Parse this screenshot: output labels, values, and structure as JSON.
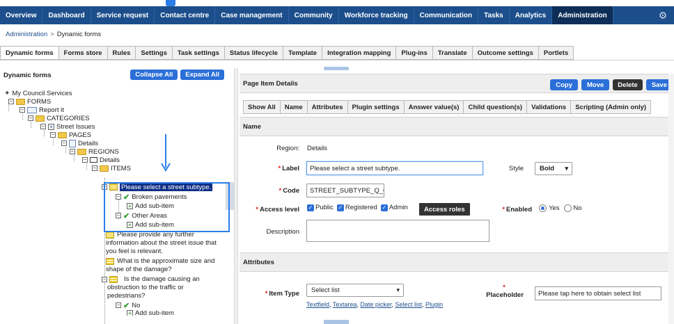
{
  "nav": {
    "items": [
      "Overview",
      "Dashboard",
      "Service request",
      "Contact centre",
      "Case management",
      "Community",
      "Workforce tracking",
      "Communication",
      "Tasks",
      "Analytics",
      "Administration"
    ],
    "active": "Administration"
  },
  "breadcrumb": {
    "root": "Administration",
    "sep": ">",
    "current": "Dynamic forms"
  },
  "subtabs": [
    "Dynamic forms",
    "Forms store",
    "Rules",
    "Settings",
    "Task settings",
    "Status lifecycle",
    "Template",
    "Integration mapping",
    "Plug-ins",
    "Translate",
    "Outcome settings",
    "Portlets"
  ],
  "left": {
    "title": "Dynamic forms",
    "collapse_label": "Collapse All",
    "expand_label": "Expand All",
    "tree": {
      "root": "My Council Services",
      "forms": "FORMS",
      "report": "Report it",
      "categories": "CATEGORIES",
      "street": "Street Issues",
      "pages": "PAGES",
      "details_page": "Details",
      "regions": "REGIONS",
      "details_region": "Details",
      "items": "ITEMS",
      "selected": "Please select a street subtype.",
      "broken": "Broken pavements",
      "add1": "Add sub-item",
      "other": "Other Areas",
      "add2": "Add sub-item",
      "q1": "Please provide any further information about the street issue that you feel is relevant.",
      "q2": "What is the approximate size and shape of the damage?",
      "q3": "Is the damage causing an obstruction to the traffic or pedestrians?",
      "no": "No",
      "add3": "Add sub-item"
    }
  },
  "right": {
    "title": "Page Item Details",
    "buttons": {
      "copy": "Copy",
      "move": "Move",
      "delete": "Delete",
      "save": "Save"
    },
    "tabs": [
      "Show All",
      "Name",
      "Attributes",
      "Plugin settings",
      "Answer value(s)",
      "Child question(s)",
      "Validations",
      "Scripting (Admin only)"
    ],
    "name_section": "Name",
    "region_label": "Region:",
    "region_value": "Details",
    "label_label": "Label",
    "label_value": "Please select a street subtype.",
    "style_label": "Style",
    "style_value": "Bold",
    "code_label": "Code",
    "code_value": "STREET_SUBTYPE_Q_GB_",
    "access_label": "Access level",
    "access_public": "Public",
    "access_registered": "Registered",
    "access_admin": "Admin",
    "access_roles": "Access roles",
    "enabled_label": "Enabled",
    "enabled_yes": "Yes",
    "enabled_no": "No",
    "description_label": "Description",
    "attributes_section": "Attributes",
    "item_type_label": "Item Type",
    "item_type_value": "Select list",
    "item_type_links": [
      "Textfield",
      "Textarea",
      "Date picker",
      "Select list",
      "Plugin"
    ],
    "placeholder_label": "Placeholder",
    "placeholder_value": "Please tap here to obtain select list"
  },
  "colors": {
    "nav_bg": "#1c4e8c",
    "nav_active": "#0d2e57",
    "accent_blue": "#2b6fd8",
    "highlight": "#2b7de9",
    "selected_node": "#0f2f86"
  }
}
